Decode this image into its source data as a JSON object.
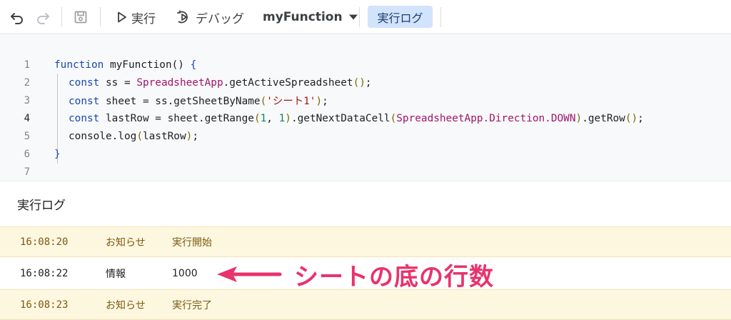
{
  "toolbar": {
    "undo_icon": "undo-icon",
    "redo_icon": "redo-icon",
    "save_icon": "save-icon",
    "run_label": "実行",
    "debug_label": "デバッグ",
    "function_select": "myFunction",
    "log_button": "実行ログ"
  },
  "editor": {
    "lines": [
      {
        "num": "1"
      },
      {
        "num": "2"
      },
      {
        "num": "3"
      },
      {
        "num": "4"
      },
      {
        "num": "5"
      },
      {
        "num": "6"
      },
      {
        "num": "7"
      }
    ],
    "tokens": {
      "l1_kw": "function",
      "l1_rest": " myFunction() ",
      "l1_brace": "{",
      "l2_kw": "const",
      "l2_a": " ss = ",
      "l2_cls": "SpreadsheetApp",
      "l2_b": ".getActiveSpreadsheet",
      "l2_par": "()",
      "l2_c": ";",
      "l3_kw": "const",
      "l3_a": " sheet = ss.getSheetByName",
      "l3_p1": "(",
      "l3_str": "'シート1'",
      "l3_p2": ")",
      "l3_c": ";",
      "l4_kw": "const",
      "l4_a": " lastRow = sheet.getRange",
      "l4_p1": "(",
      "l4_n1": "1",
      "l4_comma": ", ",
      "l4_n2": "1",
      "l4_p2": ")",
      "l4_b": ".getNextDataCell",
      "l4_p3": "(",
      "l4_cls": "SpreadsheetApp.Direction.DOWN",
      "l4_p4": ")",
      "l4_c": ".getRow",
      "l4_p5": "()",
      "l4_d": ";",
      "l5_a": "console.log",
      "l5_p1": "(",
      "l5_b": "lastRow",
      "l5_p2": ")",
      "l5_c": ";",
      "l6_brace": "}"
    }
  },
  "log": {
    "title": "実行ログ",
    "rows": [
      {
        "time": "16:08:20",
        "level": "お知らせ",
        "message": "実行開始"
      },
      {
        "time": "16:08:22",
        "level": "情報",
        "message": "1000"
      },
      {
        "time": "16:08:23",
        "level": "お知らせ",
        "message": "実行完了"
      }
    ]
  },
  "annotation": {
    "text": "シートの底の行数",
    "color": "#e8336d"
  }
}
